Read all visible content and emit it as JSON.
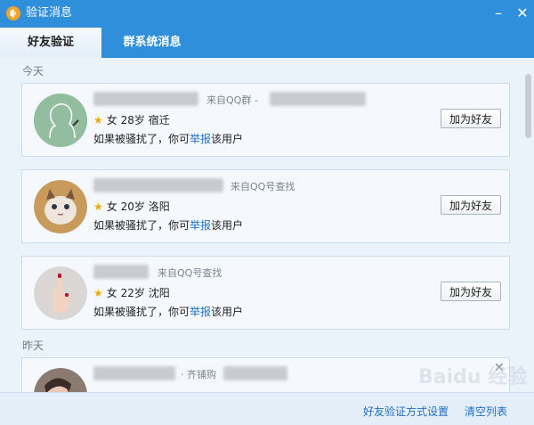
{
  "window": {
    "title": "验证消息"
  },
  "tabs": [
    {
      "label": "好友验证"
    },
    {
      "label": "群系统消息"
    }
  ],
  "sections": {
    "today": "今天",
    "yesterday": "昨天"
  },
  "requests": [
    {
      "source": "来自QQ群 -",
      "gender": "女",
      "age": "28岁",
      "city": "宿迁",
      "hint_before": "如果被骚扰了，你可",
      "hint_link": "举报",
      "hint_after": "该用户",
      "action": "加为好友"
    },
    {
      "source": "来自QQ号查找",
      "gender": "女",
      "age": "20岁",
      "city": "洛阳",
      "hint_before": "如果被骚扰了，你可",
      "hint_link": "举报",
      "hint_after": "该用户",
      "action": "加为好友"
    },
    {
      "source": "来自QQ号查找",
      "gender": "女",
      "age": "22岁",
      "city": "沈阳",
      "hint_before": "如果被骚扰了，你可",
      "hint_link": "举报",
      "hint_after": "该用户",
      "action": "加为好友"
    },
    {
      "source": "· 齐铺购"
    }
  ],
  "footer": {
    "settings_link": "好友验证方式设置",
    "clear_link": "清空列表"
  },
  "watermark": "Baidu 经验",
  "colors": {
    "titlebar": "#2f8fdb",
    "link": "#1f6fc5",
    "star": "#f0a800"
  }
}
